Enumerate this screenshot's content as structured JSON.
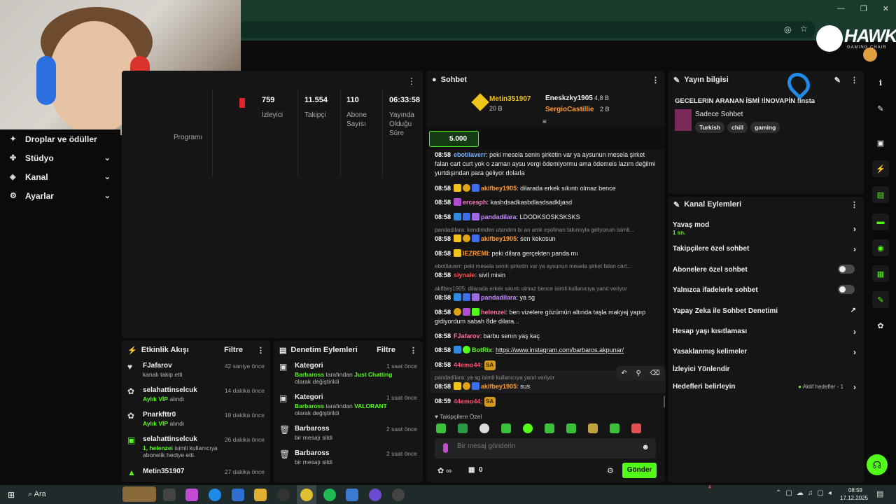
{
  "browser": {
    "window_controls": [
      "—",
      "❐",
      "✕"
    ]
  },
  "left_nav": {
    "items": [
      {
        "label": "Droplar ve ödüller",
        "icon": "gift-icon"
      },
      {
        "label": "Stüdyo",
        "icon": "studio-icon"
      },
      {
        "label": "Kanal",
        "icon": "channel-icon"
      },
      {
        "label": "Ayarlar",
        "icon": "gear-icon"
      }
    ]
  },
  "stats": {
    "program_label": "Programı",
    "items": [
      {
        "value": "759",
        "label": "İzleyici"
      },
      {
        "value": "11.554",
        "label": "Takipçi"
      },
      {
        "value": "110",
        "label": "Abone Sayısı"
      },
      {
        "value": "06:33:58",
        "label": "Yayında Olduğu Süre"
      }
    ]
  },
  "activity": {
    "title": "Etkinlik Akışı",
    "filter": "Filtre",
    "rows": [
      {
        "name": "FJafarov",
        "desc": "kanalı takip etti",
        "time": "42 saniye önce",
        "icon": "heart-icon"
      },
      {
        "name": "selahattinselcuk",
        "desc_green": "Aylık VİP",
        "desc": " alındı",
        "time": "14 dakika önce",
        "icon": "gift-icon"
      },
      {
        "name": "Pnarkfttr0",
        "desc_green": "Aylık VİP",
        "desc": " alındı",
        "time": "19 dakika önce",
        "icon": "gift-icon"
      },
      {
        "name": "selahattinselcuk",
        "desc_green": "1, helenzei",
        "desc": " isimli kullanıcıya abonelik hediye etti.",
        "time": "26 dakika önce",
        "icon": "sub-gift-icon"
      },
      {
        "name": "Metin351907",
        "desc": "",
        "time": "27 dakika önce",
        "icon": "crown-icon"
      }
    ]
  },
  "moderation": {
    "title": "Denetim Eylemleri",
    "filter": "Filtre",
    "rows": [
      {
        "name": "Kategori",
        "pre": "Barbaross",
        "mid": " tarafından ",
        "green": "Just Chatting",
        "post": " olarak değiştirildi",
        "time": "1 saat önce"
      },
      {
        "name": "Kategori",
        "pre": "Barbaross",
        "mid": " tarafından ",
        "green": "VALORANT",
        "post": " olarak değiştirildi",
        "time": "1 saat önce"
      },
      {
        "name": "Barbaross",
        "desc": "bir mesajı sildi",
        "time": "2 saat önce"
      },
      {
        "name": "Barbaross",
        "desc": "bir mesajı sildi",
        "time": "2 saat önce"
      }
    ]
  },
  "chat": {
    "title": "Sohbet",
    "leaderboard": [
      {
        "name": "Metin351907",
        "amount": "20 B"
      },
      {
        "name": "Eneskzky1905",
        "amount": "4,8 B"
      },
      {
        "name": "SergioCastillie",
        "amount": "2 B"
      }
    ],
    "goal": "5.000",
    "messages": [
      {
        "time": "08:58",
        "user": "ebotilaverr",
        "color": "#7ab4ff",
        "text": ": peki mesela senin şirketin var ya aysunun mesela şirket falan cart curt yok o zaman aysu vergi ödemiyormu ama ödemeis lazım değilmi yurtdışından para geliyor dolarla"
      },
      {
        "time": "08:58",
        "user": "akifbey1905",
        "color": "#ff9d3c",
        "text": ": dilarada erkek sıkıntı olmaz bence"
      },
      {
        "time": "08:58",
        "user": "ercesph",
        "color": "#ff7ac8",
        "text": ": kashdsadkasbdlasdsadkljasd"
      },
      {
        "time": "08:58",
        "user": "pandadilara",
        "color": "#c48bff",
        "text": ": LDODKSOSKSKSKS"
      },
      {
        "time": "08:58",
        "user": "akifbey1905",
        "color": "#ff9d3c",
        "text": ": sen kekosun"
      },
      {
        "time": "08:58",
        "user": "IEZREMI",
        "color": "#ff9d3c",
        "text": ": peki dilara gerçekten panda mı"
      },
      {
        "time": "08:58",
        "user": "siynale",
        "color": "#ff4d4d",
        "text": ": sivil misin"
      },
      {
        "time": "08:58",
        "user": "pandadilara",
        "color": "#c48bff",
        "text": ": ya sg"
      },
      {
        "time": "08:58",
        "user": "helenzei",
        "color": "#ff6b9a",
        "text": ": ben vizelere gözümün altında taşla makyaj yapıp gidiyordum sabah 8de dilara..."
      },
      {
        "time": "08:58",
        "user": "FJafarov",
        "color": "#ff6b9a",
        "text": ": barbu senın yaş kaç"
      },
      {
        "time": "08:58",
        "user": "BotRix",
        "color": "#53fc18",
        "text": ": ",
        "link": "https://www.instagram.com/barbaros.akpunar/"
      },
      {
        "time": "08:58",
        "user": "44emo44",
        "color": "#ff4d6d",
        "text": ":",
        "emote": "SA"
      },
      {
        "time": "08:58",
        "user": "akifbey1905",
        "color": "#ff9d3c",
        "text": ": sus"
      },
      {
        "time": "08:59",
        "user": "44emo44",
        "color": "#ff4d6d",
        "text": ":",
        "emote": "SA"
      }
    ],
    "replies": [
      "pandadilara: kendimden utandım bı an amk eşofman takımıyla geliyorum isimli...",
      "ebotilaverr: peki mesela senin şirketin var ya aysunun mesela şirket falan cart...",
      "akifbey1905: dilarada erkek sıkıntı olmaz bence isimli kullanıcıya yanıt veriyor",
      "pandadilara: ya sg isimli kullanıcıya yanıt veriyor"
    ],
    "followers_only": "Takipçilere Özel",
    "input_placeholder": "Bir mesaj gönderin",
    "points": "∞",
    "count": "0",
    "send": "Gönder"
  },
  "stream_info": {
    "title": "Yayın bilgisi",
    "stream_title": "GECELERIN ARANAN İSMİ !İNOVAPİN !insta",
    "category": "Sadece Sohbet",
    "tags": [
      "Turkish",
      "chill",
      "gaming"
    ]
  },
  "channel_actions": {
    "title": "Kanal Eylemleri",
    "slow_mode": "Yavaş mod",
    "slow_value": "1 sn.",
    "items": [
      "Takipçilere özel sohbet",
      "Abonelere özel sohbet",
      "Yalnızca ifadelerle sohbet",
      "Yapay Zeka ile Sohbet Denetimi",
      "Hesap yaşı kısıtlaması",
      "Yasaklanmış kelimeler",
      "İzleyici Yönlendir",
      "Hedefleri belirleyin"
    ],
    "active_goals": "Aktif hedefler - 1"
  },
  "overlay": {
    "brand": "HAWK",
    "brand_sub": "GAMING CHAIR"
  },
  "taskbar": {
    "search": "Ara",
    "time": "08:59",
    "date": "17.12.2025",
    "notif": "4"
  },
  "colors": {
    "accent": "#53fc18",
    "panel": "#151516",
    "bg": "#0b0b0c"
  }
}
